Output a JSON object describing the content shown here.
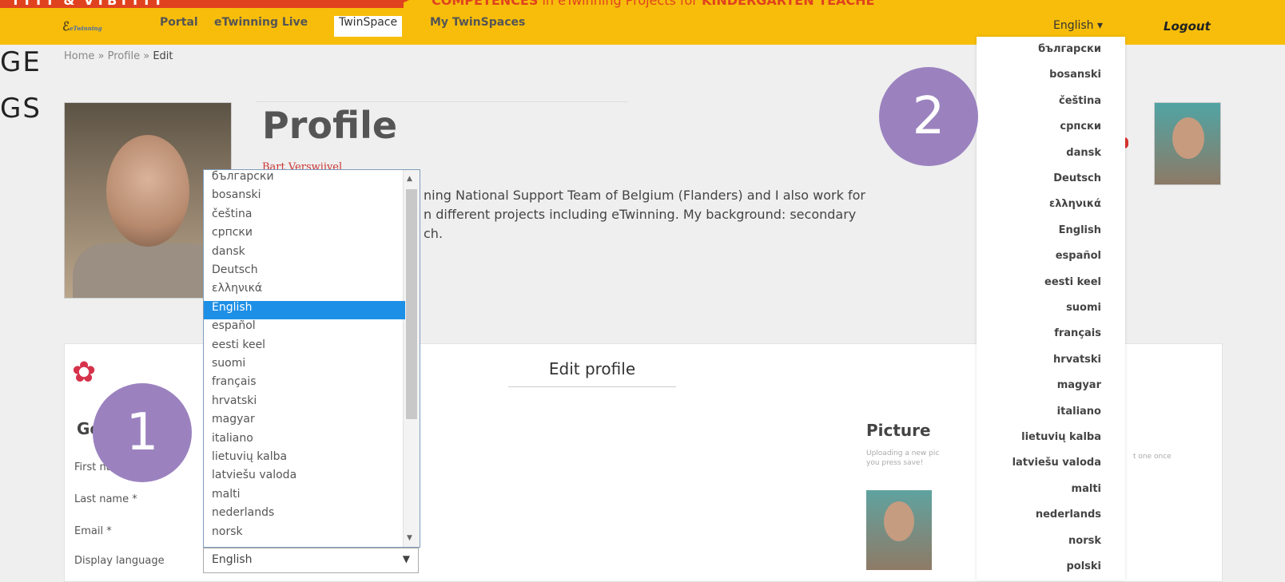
{
  "banner": {
    "left_text": "TTTT & VTBTTTT",
    "right_prefix": "COMPETENCES",
    "right_mid": " in eTwinning Projects for ",
    "right_suffix": "KINDERGARTEN TEACHE"
  },
  "nav": {
    "logo_text": "eTwinning",
    "links": [
      "Portal",
      "eTwinning Live",
      "TwinSpace",
      "My TwinSpaces"
    ],
    "language": "English ▾",
    "logout": "Logout"
  },
  "slide_text": {
    "line1": "GE",
    "line2": "GS"
  },
  "breadcrumb": {
    "home": "Home",
    "sep": "»",
    "profile": "Profile",
    "current": "Edit"
  },
  "profile": {
    "title": "Profile",
    "name": "Bart Verswijvel",
    "bio_line1": "ning National Support Team of Belgium (Flanders) and I also work for",
    "bio_line2": "n different projects including eTwinning. My background: secondary",
    "bio_line3": "ch."
  },
  "badges": {
    "one": "1",
    "two": "2"
  },
  "edit_profile": {
    "heading": "Edit profile",
    "section": "Ge",
    "fields": [
      "First name *",
      "Last name *",
      "Email *",
      "Display language"
    ],
    "display_language_value": "English"
  },
  "dropdown_options": [
    "български",
    "bosanski",
    "čeština",
    "српски",
    "dansk",
    "Deutsch",
    "ελληνικά",
    "English",
    "español",
    "eesti keel",
    "suomi",
    "français",
    "hrvatski",
    "magyar",
    "italiano",
    "lietuvių kalba",
    "latviešu valoda",
    "malti",
    "nederlands",
    "norsk"
  ],
  "dropdown_selected": "English",
  "language_menu": [
    "български",
    "bosanski",
    "čeština",
    "српски",
    "dansk",
    "Deutsch",
    "ελληνικά",
    "English",
    "español",
    "eesti keel",
    "suomi",
    "français",
    "hrvatski",
    "magyar",
    "italiano",
    "lietuvių kalba",
    "latviešu valoda",
    "malti",
    "nederlands",
    "norsk",
    "polski"
  ],
  "picture": {
    "title": "Picture",
    "note": "Uploading a new pic",
    "note_end": "you press save!",
    "note_right": "t one once"
  },
  "colors": {
    "nav": "#f7bd0a",
    "badge": "#9b82bf",
    "accent_red": "#e0421f",
    "select_blue": "#1e8fe6"
  }
}
